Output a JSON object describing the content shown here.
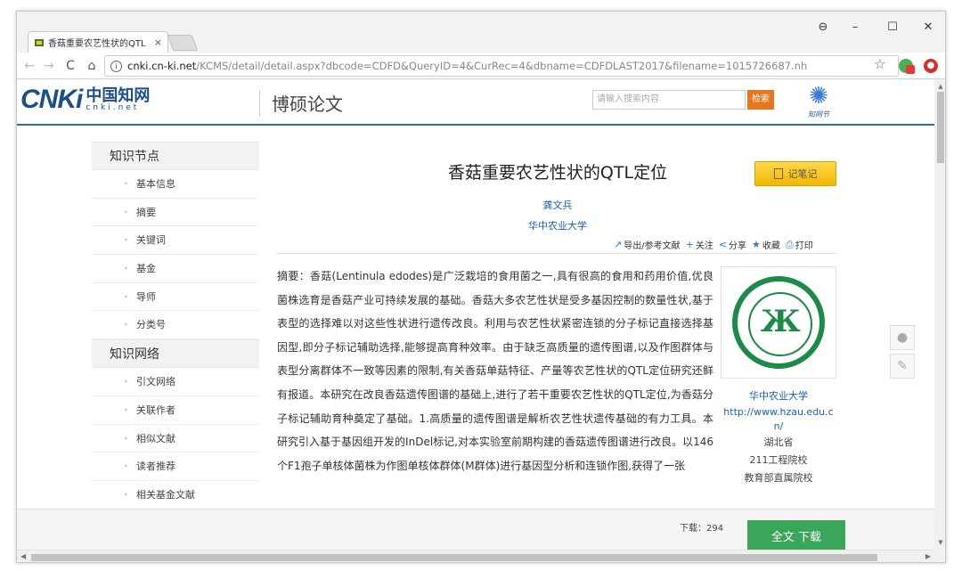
{
  "browser": {
    "tab_title": "香菇重要农艺性状的QTL",
    "tab_close": "×",
    "url_host": "cnki.cn-ki.net",
    "url_path": "/KCMS/detail/detail.aspx?dbcode=CDFD&QueryID=4&CurRec=4&dbname=CDFDLAST2017&filename=1015726687.nh",
    "info_icon": "i",
    "win_user": "⊖",
    "win_min": "–",
    "win_max": "☐",
    "win_close": "✕"
  },
  "site": {
    "logo_latin": "CNKi",
    "logo_cn": "中国知网",
    "logo_sub": "cnki.net",
    "section": "博硕论文",
    "search_placeholder": "请输入搜索内容",
    "search_button": "检索",
    "zhiwang_label": "知网节"
  },
  "sidebar": {
    "group1_title": "知识节点",
    "group1_items": [
      "基本信息",
      "摘要",
      "关键词",
      "基金",
      "导师",
      "分类号"
    ],
    "group2_title": "知识网络",
    "group2_items": [
      "引文网络",
      "关联作者",
      "相似文献",
      "读者推荐",
      "相关基金文献"
    ]
  },
  "paper": {
    "title": "香菇重要农艺性状的QTL定位",
    "note_button": "记笔记",
    "author": "龚文兵",
    "affiliation": "华中农业大学",
    "actions": {
      "export": "导出/参考文献",
      "follow": "关注",
      "share": "分享",
      "favorite": "收藏",
      "print": "打印"
    },
    "abstract": "摘要：香菇(Lentinula edodes)是广泛栽培的食用菌之一,具有很高的食用和药用价值,优良菌株选育是香菇产业可持续发展的基础。香菇大多农艺性状是受多基因控制的数量性状,基于表型的选择难以对这些性状进行遗传改良。利用与农艺性状紧密连锁的分子标记直接选择基因型,即分子标记辅助选择,能够提高育种效率。由于缺乏高质量的遗传图谱,以及作图群体与表型分离群体不一致等因素的限制,有关香菇单菇特征、产量等农艺性状的QTL定位研究还鲜有报道。本研究在改良香菇遗传图谱的基础上,进行了若干重要农艺性状的QTL定位,为香菇分子标记辅助育种奠定了基础。1.高质量的遗传图谱是解析农艺性状遗传基础的有力工具。本研究引入基于基因组开发的InDel标记,对本实验室前期构建的香菇遗传图谱进行改良。以146个F1孢子单核体菌株为作图单核体群体(M群体)进行基因型分析和连锁作图,获得了一张"
  },
  "school": {
    "name": "华中农业大学",
    "url": "http://www.hzau.edu.cn/",
    "province": "湖北省",
    "tag1": "211工程院校",
    "tag2": "教育部直属院校"
  },
  "footer": {
    "download_count": "下载：294",
    "download_button": "全文 下载"
  },
  "colors": {
    "brand_blue": "#1d4f8c",
    "link_blue": "#1a5fb4",
    "download_green": "#3aa659",
    "note_yellow": "#f0b800",
    "search_orange": "#e8771c",
    "emblem_green": "#1c8a48"
  }
}
